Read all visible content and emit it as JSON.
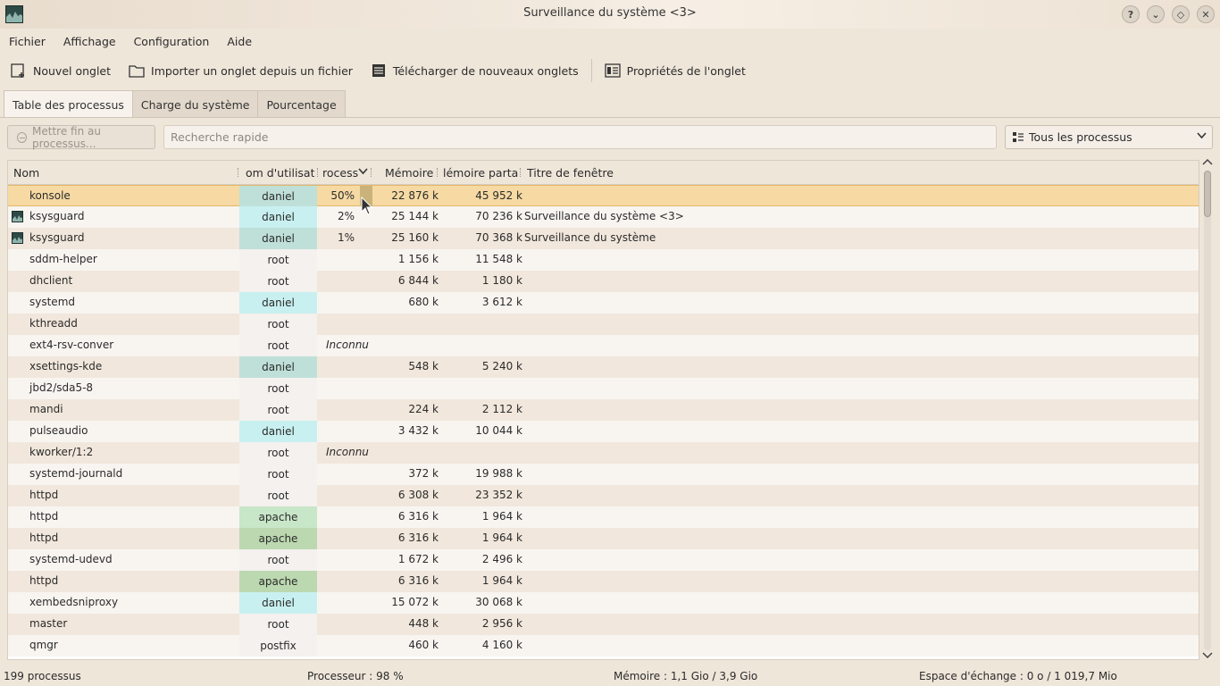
{
  "window": {
    "title": "Surveillance du système <3>",
    "buttons": [
      "?",
      "⌄",
      "◇",
      "✕"
    ]
  },
  "menu": [
    "Fichier",
    "Affichage",
    "Configuration",
    "Aide"
  ],
  "toolbar": {
    "new_tab": "Nouvel onglet",
    "import_tab": "Importer un onglet depuis un fichier",
    "download_tabs": "Télécharger de nouveaux onglets",
    "tab_properties": "Propriétés de l'onglet"
  },
  "tabs": [
    "Table des processus",
    "Charge du système",
    "Pourcentage"
  ],
  "filter": {
    "kill_label": "Mettre fin au processus...",
    "search_placeholder": "Recherche rapide",
    "process_filter": "Tous les processus"
  },
  "columns": {
    "name": "Nom",
    "user": "om d'utilisateu",
    "cpu": "rocesse",
    "memory": "Mémoire",
    "shared": "lémoire partagé",
    "window_title": "Titre de fenêtre"
  },
  "rows": [
    {
      "name": "konsole",
      "user": "daniel",
      "cpu": "50%",
      "mem": "22 876 k",
      "shared": "45 952 k",
      "title": ""
    },
    {
      "name": "ksysguard",
      "user": "daniel",
      "cpu": "2%",
      "mem": "25 144 k",
      "shared": "70 236 k",
      "title": "Surveillance du système <3>"
    },
    {
      "name": "ksysguard",
      "user": "daniel",
      "cpu": "1%",
      "mem": "25 160 k",
      "shared": "70 368 k",
      "title": "Surveillance du système"
    },
    {
      "name": "sddm-helper",
      "user": "root",
      "cpu": "",
      "mem": "1 156 k",
      "shared": "11 548 k",
      "title": ""
    },
    {
      "name": "dhclient",
      "user": "root",
      "cpu": "",
      "mem": "6 844 k",
      "shared": "1 180 k",
      "title": ""
    },
    {
      "name": "systemd",
      "user": "daniel",
      "cpu": "",
      "mem": "680 k",
      "shared": "3 612 k",
      "title": ""
    },
    {
      "name": "kthreadd",
      "user": "root",
      "cpu": "",
      "mem": "",
      "shared": "",
      "title": ""
    },
    {
      "name": "ext4-rsv-conver",
      "user": "root",
      "cpu": "Inconnu",
      "mem": "",
      "shared": "",
      "title": ""
    },
    {
      "name": "xsettings-kde",
      "user": "daniel",
      "cpu": "",
      "mem": "548 k",
      "shared": "5 240 k",
      "title": ""
    },
    {
      "name": "jbd2/sda5-8",
      "user": "root",
      "cpu": "",
      "mem": "",
      "shared": "",
      "title": ""
    },
    {
      "name": "mandi",
      "user": "root",
      "cpu": "",
      "mem": "224 k",
      "shared": "2 112 k",
      "title": ""
    },
    {
      "name": "pulseaudio",
      "user": "daniel",
      "cpu": "",
      "mem": "3 432 k",
      "shared": "10 044 k",
      "title": ""
    },
    {
      "name": "kworker/1:2",
      "user": "root",
      "cpu": "Inconnu",
      "mem": "",
      "shared": "",
      "title": ""
    },
    {
      "name": "systemd-journald",
      "user": "root",
      "cpu": "",
      "mem": "372 k",
      "shared": "19 988 k",
      "title": ""
    },
    {
      "name": "httpd",
      "user": "root",
      "cpu": "",
      "mem": "6 308 k",
      "shared": "23 352 k",
      "title": ""
    },
    {
      "name": "httpd",
      "user": "apache",
      "cpu": "",
      "mem": "6 316 k",
      "shared": "1 964 k",
      "title": ""
    },
    {
      "name": "httpd",
      "user": "apache",
      "cpu": "",
      "mem": "6 316 k",
      "shared": "1 964 k",
      "title": ""
    },
    {
      "name": "systemd-udevd",
      "user": "root",
      "cpu": "",
      "mem": "1 672 k",
      "shared": "2 496 k",
      "title": ""
    },
    {
      "name": "httpd",
      "user": "apache",
      "cpu": "",
      "mem": "6 316 k",
      "shared": "1 964 k",
      "title": ""
    },
    {
      "name": "xembedsniproxy",
      "user": "daniel",
      "cpu": "",
      "mem": "15 072 k",
      "shared": "30 068 k",
      "title": ""
    },
    {
      "name": "master",
      "user": "root",
      "cpu": "",
      "mem": "448 k",
      "shared": "2 956 k",
      "title": ""
    },
    {
      "name": "qmgr",
      "user": "postfix",
      "cpu": "",
      "mem": "460 k",
      "shared": "4 160 k",
      "title": ""
    }
  ],
  "status": {
    "count": "199 processus",
    "cpu": "Processeur : 98 %",
    "memory": "Mémoire : 1,1 Gio / 3,9 Gio",
    "swap": "Espace d'échange : 0 o / 1 019,7 Mio"
  },
  "colors": {
    "user_daniel": "#c9f0f0",
    "user_daniel_alt": "#bfe0d8",
    "user_root": "#f4f1ee",
    "user_apache": "#c8e6c8",
    "user_apache_alt": "#bcd8b0",
    "user_postfix": "#f4f1ee",
    "selected": "#f6d9a3"
  }
}
